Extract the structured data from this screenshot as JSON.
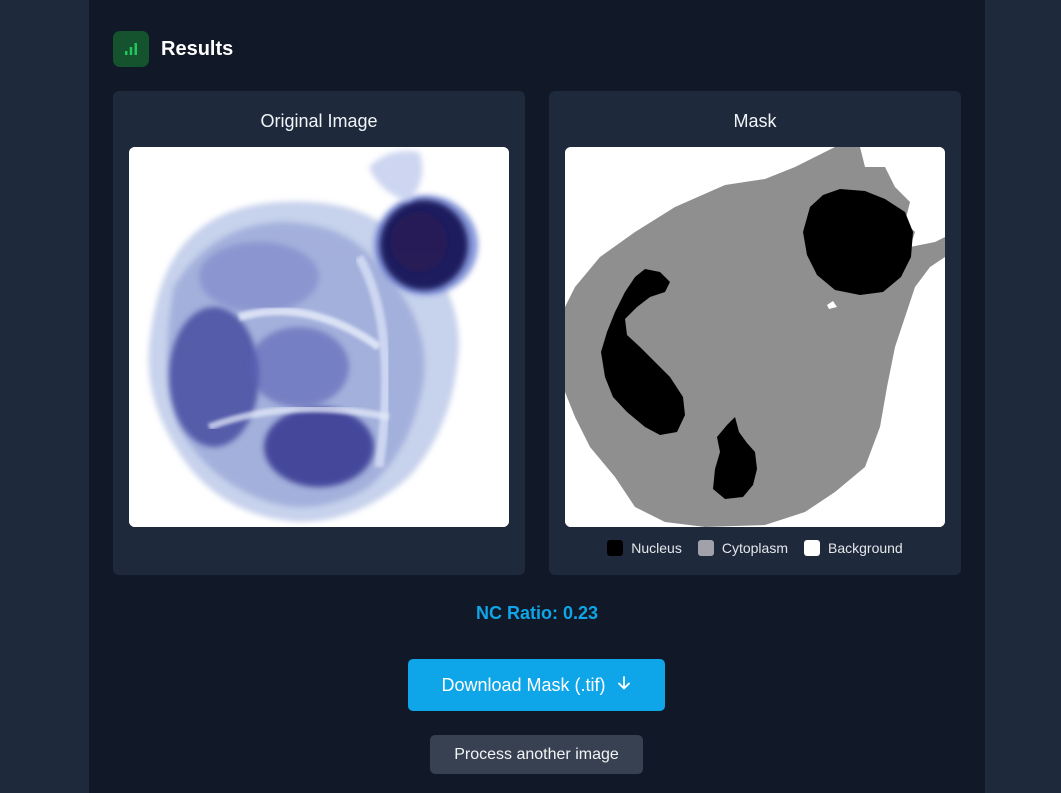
{
  "results": {
    "title": "Results",
    "icon": "bar-chart-icon",
    "accent_color": "#22c55e"
  },
  "original_card": {
    "title": "Original Image"
  },
  "mask_card": {
    "title": "Mask",
    "legend": [
      {
        "label": "Nucleus",
        "color": "#000000"
      },
      {
        "label": "Cytoplasm",
        "color": "#a1a1aa"
      },
      {
        "label": "Background",
        "color": "#ffffff"
      }
    ]
  },
  "nc_ratio_text": "NC Ratio: 0.23",
  "download_button": {
    "label": "Download Mask (.tif)",
    "icon": "arrow-down-icon",
    "color": "#0ea5e9"
  },
  "process_button": {
    "label": "Process another image"
  }
}
